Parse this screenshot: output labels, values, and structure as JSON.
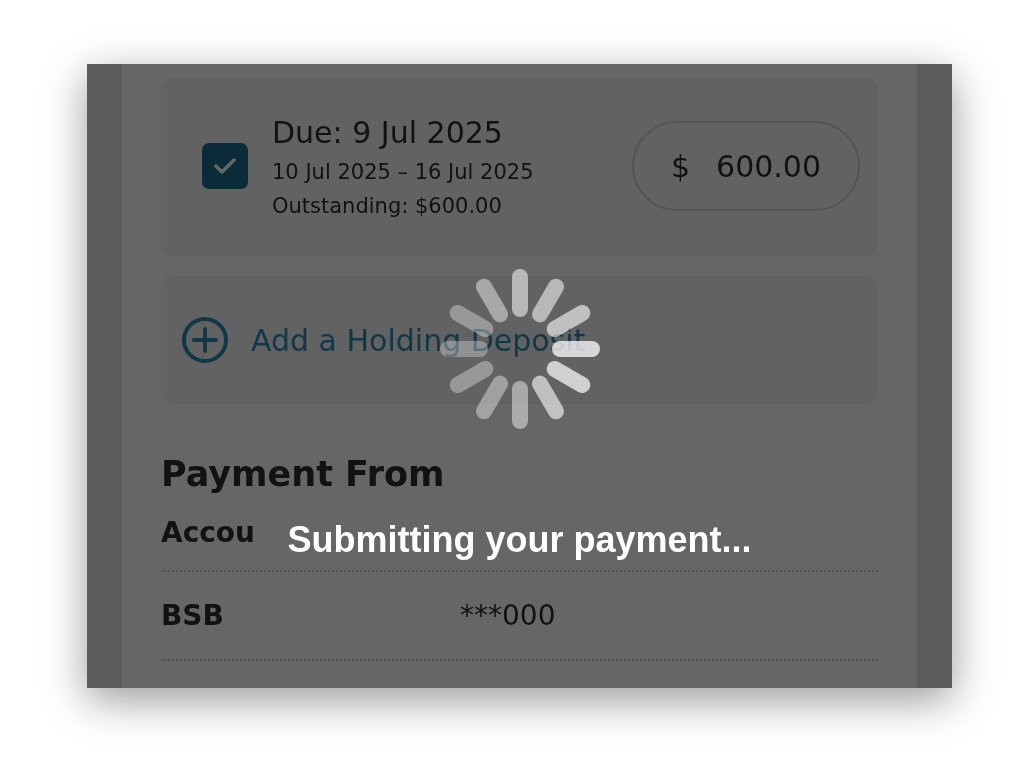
{
  "instalment": {
    "checked": true,
    "due": "Due: 9 Jul 2025",
    "period": "10 Jul 2025 – 16 Jul 2025",
    "outstanding": "Outstanding: $600.00",
    "currency": "$",
    "amount": "600.00"
  },
  "add_deposit": {
    "label": "Add a Holding Deposit"
  },
  "payment_from": {
    "heading": "Payment From",
    "rows": [
      {
        "label": "Accou"
      },
      {
        "label": "BSB",
        "value": "***000"
      }
    ]
  },
  "overlay": {
    "message": "Submitting your payment..."
  }
}
